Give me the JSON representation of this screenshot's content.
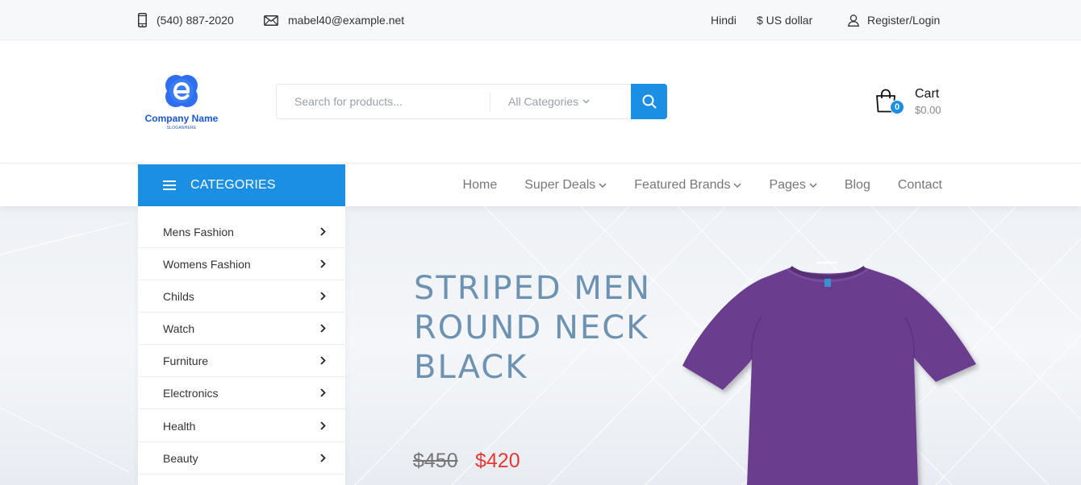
{
  "topbar": {
    "phone": "(540) 887-2020",
    "email": "mabel40@example.net",
    "language": "Hindi",
    "currency": "$ US dollar",
    "login": "Register/Login"
  },
  "header": {
    "logo_name": "Company Name",
    "logo_slogan": "SLOGANHERE",
    "search_placeholder": "Search for products...",
    "search_category": "All Categories",
    "cart_title": "Cart",
    "cart_total": "$0.00",
    "cart_count": "0"
  },
  "nav": {
    "categories_label": "CATEGORIES",
    "links": {
      "home": "Home",
      "super_deals": "Super Deals",
      "featured_brands": "Featured Brands",
      "pages": "Pages",
      "blog": "Blog",
      "contact": "Contact"
    }
  },
  "categories": {
    "items": [
      {
        "label": "Mens Fashion"
      },
      {
        "label": "Womens Fashion"
      },
      {
        "label": "Childs"
      },
      {
        "label": "Watch"
      },
      {
        "label": "Furniture"
      },
      {
        "label": "Electronics"
      },
      {
        "label": "Health"
      },
      {
        "label": "Beauty"
      }
    ]
  },
  "hero": {
    "title_line1": "STRIPED MEN",
    "title_line2": "ROUND NECK",
    "title_line3": "BLACK",
    "old_price": "$450",
    "new_price": "$420"
  },
  "colors": {
    "accent": "#1a8fe3",
    "brand": "#1a56d8",
    "price_red": "#e53935",
    "hero_title": "#6d92b2",
    "tshirt": "#6a3d8e"
  }
}
